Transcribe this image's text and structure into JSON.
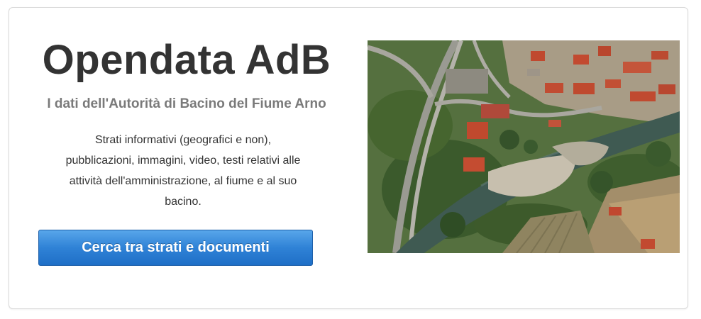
{
  "hero": {
    "title": "Opendata AdB",
    "subtitle": "I dati dell'Autorità di Bacino del Fiume Arno",
    "description_lines": [
      "Strati informativi (geografici e non),",
      "pubblicazioni, immagini, video, testi relativi alle",
      "attività dell'amministrazione, al fiume e al suo",
      "bacino."
    ],
    "cta_label": "Cerca tra strati e documenti"
  },
  "colors": {
    "button_top": "#58a6ea",
    "button_bottom": "#1f6fc7",
    "title": "#333333",
    "subtitle": "#7a7a7a"
  }
}
